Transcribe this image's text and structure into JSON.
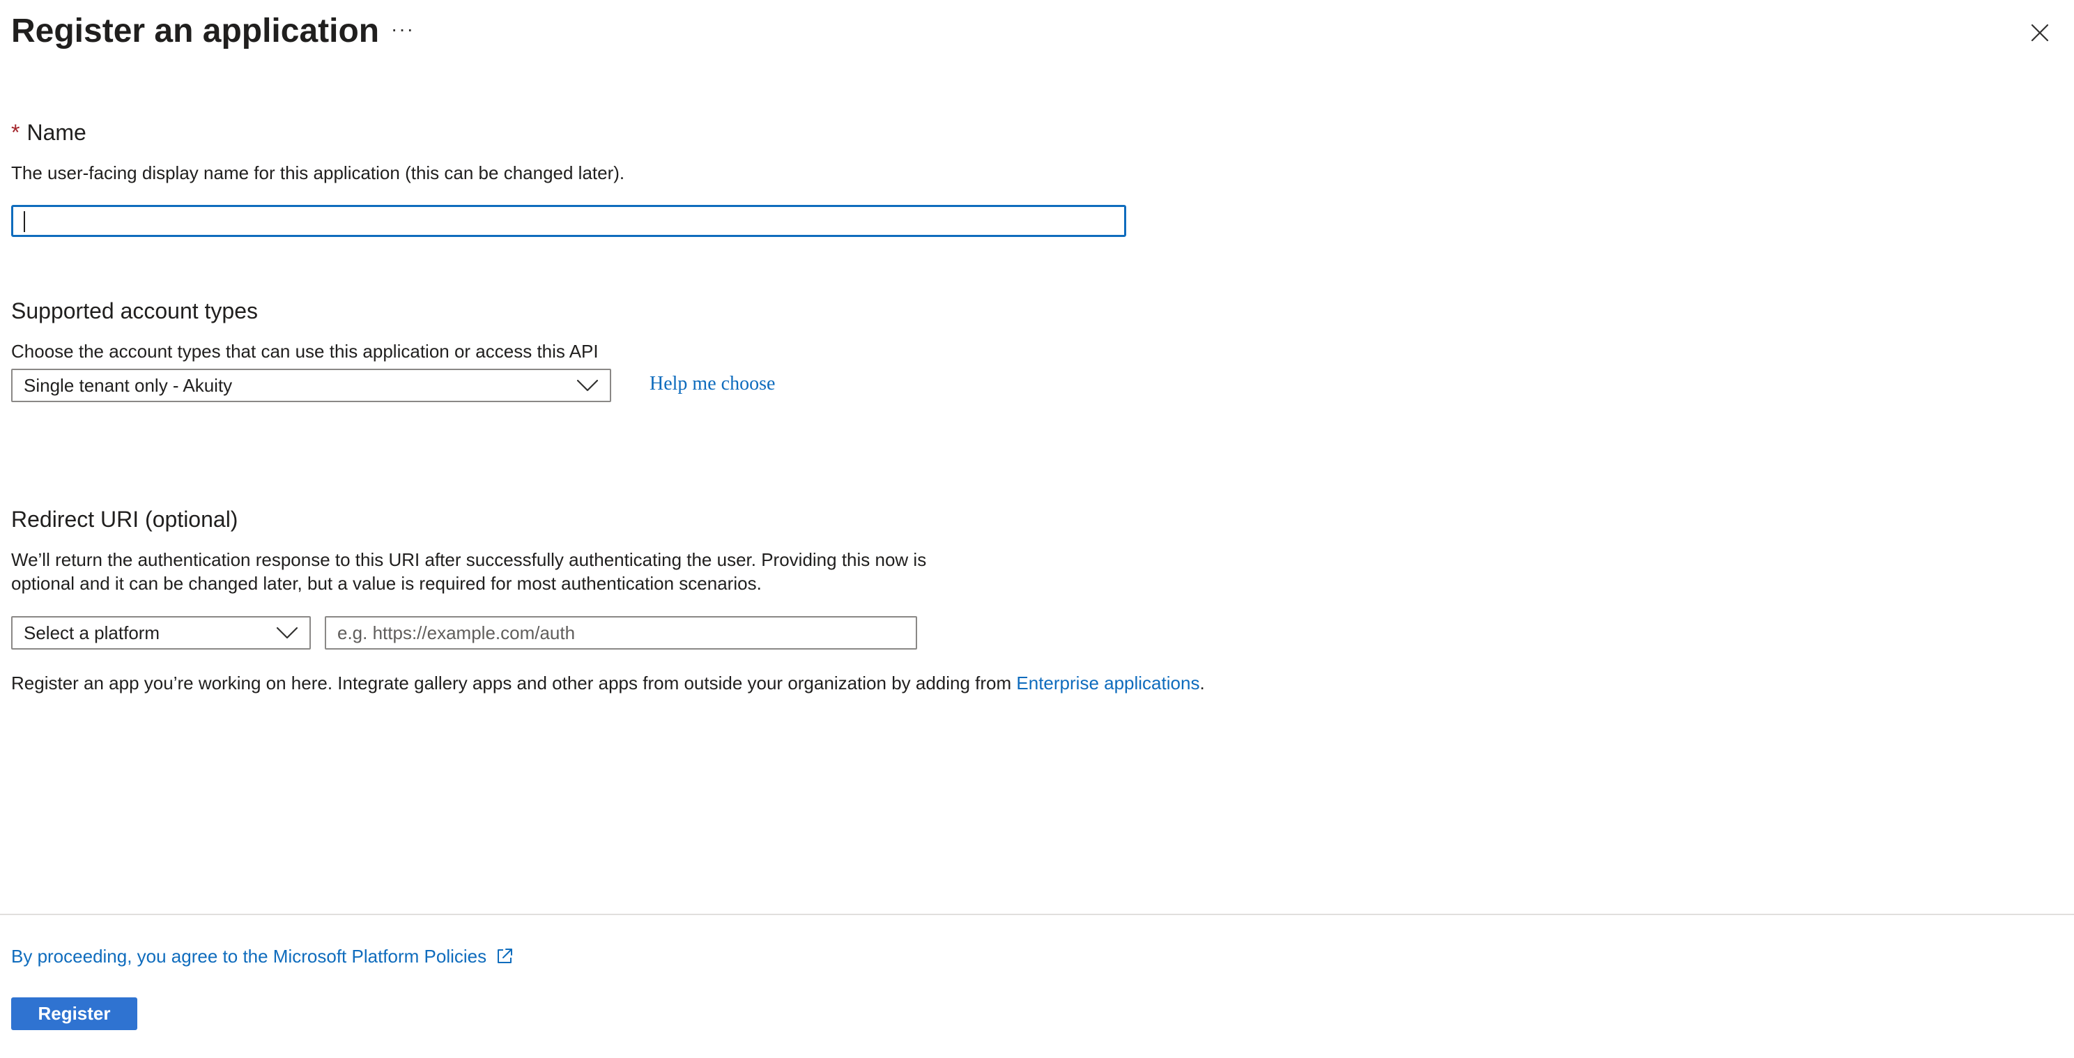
{
  "header": {
    "title": "Register an application",
    "more_label": "···",
    "close_icon": "close-icon"
  },
  "name_section": {
    "required_marker": "*",
    "label": "Name",
    "description": "The user-facing display name for this application (this can be changed later).",
    "input_value": ""
  },
  "account_types": {
    "label": "Supported account types",
    "description": "Choose the account types that can use this application or access this API",
    "selected": "Single tenant only - Akuity",
    "help_link": "Help me choose"
  },
  "redirect": {
    "label": "Redirect URI (optional)",
    "description_line1": "We’ll return the authentication response to this URI after successfully authenticating the user. Providing this now is",
    "description_line2": "optional and it can be changed later, but a value is required for most authentication scenarios.",
    "platform_selected": "Select a platform",
    "uri_placeholder": "e.g. https://example.com/auth",
    "uri_value": ""
  },
  "note": {
    "text": "Register an app you’re working on here. Integrate gallery apps and other apps from outside your organization by adding from ",
    "link": "Enterprise applications",
    "suffix": "."
  },
  "footer": {
    "policy_link": "By proceeding, you agree to the Microsoft Platform Policies",
    "policy_icon": "external-link-icon",
    "register_label": "Register"
  },
  "colors": {
    "accent": "#0f6cbd",
    "button": "#2f73d1",
    "required": "#a4262c",
    "divider": "#e1dfdd"
  }
}
